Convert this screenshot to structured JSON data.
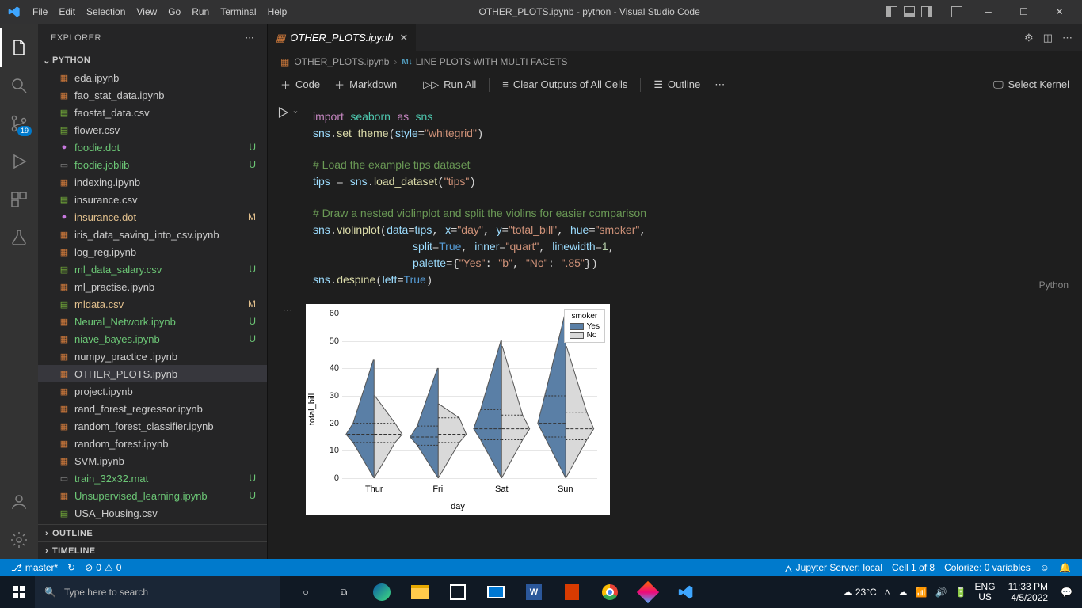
{
  "titlebar": {
    "menu": [
      "File",
      "Edit",
      "Selection",
      "View",
      "Go",
      "Run",
      "Terminal",
      "Help"
    ],
    "title": "OTHER_PLOTS.ipynb - python - Visual Studio Code"
  },
  "activitybar": {
    "scm_badge": "19"
  },
  "sidebar": {
    "title": "EXPLORER",
    "root": "PYTHON",
    "files": [
      {
        "name": "eda.ipynb",
        "icon": "nb",
        "status": ""
      },
      {
        "name": "fao_stat_data.ipynb",
        "icon": "nb",
        "status": ""
      },
      {
        "name": "faostat_data.csv",
        "icon": "csv",
        "status": ""
      },
      {
        "name": "flower.csv",
        "icon": "csv",
        "status": ""
      },
      {
        "name": "foodie.dot",
        "icon": "dot",
        "status": "U"
      },
      {
        "name": "foodie.joblib",
        "icon": "file",
        "status": "U"
      },
      {
        "name": "indexing.ipynb",
        "icon": "nb",
        "status": ""
      },
      {
        "name": "insurance.csv",
        "icon": "csv",
        "status": ""
      },
      {
        "name": "insurance.dot",
        "icon": "dot",
        "status": "M"
      },
      {
        "name": "iris_data_saving_into_csv.ipynb",
        "icon": "nb",
        "status": ""
      },
      {
        "name": "log_reg.ipynb",
        "icon": "nb",
        "status": ""
      },
      {
        "name": "ml_data_salary.csv",
        "icon": "csv",
        "status": "U"
      },
      {
        "name": "ml_practise.ipynb",
        "icon": "nb",
        "status": ""
      },
      {
        "name": "mldata.csv",
        "icon": "csv",
        "status": "M"
      },
      {
        "name": "Neural_Network.ipynb",
        "icon": "nb",
        "status": "U"
      },
      {
        "name": "niave_bayes.ipynb",
        "icon": "nb",
        "status": "U"
      },
      {
        "name": "numpy_practice .ipynb",
        "icon": "nb",
        "status": ""
      },
      {
        "name": "OTHER_PLOTS.ipynb",
        "icon": "nb",
        "status": "",
        "selected": true
      },
      {
        "name": "project.ipynb",
        "icon": "nb",
        "status": ""
      },
      {
        "name": "rand_forest_regressor.ipynb",
        "icon": "nb",
        "status": ""
      },
      {
        "name": "random_forest_classifier.ipynb",
        "icon": "nb",
        "status": ""
      },
      {
        "name": "random_forest.ipynb",
        "icon": "nb",
        "status": ""
      },
      {
        "name": "SVM.ipynb",
        "icon": "nb",
        "status": ""
      },
      {
        "name": "train_32x32.mat",
        "icon": "file",
        "status": "U"
      },
      {
        "name": "Unsupervised_learning.ipynb",
        "icon": "nb",
        "status": "U"
      },
      {
        "name": "USA_Housing.csv",
        "icon": "csv",
        "status": ""
      }
    ],
    "outline": "OUTLINE",
    "timeline": "TIMELINE"
  },
  "editor": {
    "tab_name": "OTHER_PLOTS.ipynb",
    "breadcrumb_file": "OTHER_PLOTS.ipynb",
    "breadcrumb_section": "LINE PLOTS WITH MULTI FACETS",
    "toolbar": {
      "code": "Code",
      "markdown": "Markdown",
      "run_all": "Run All",
      "clear_outputs": "Clear Outputs of All Cells",
      "outline": "Outline",
      "select_kernel": "Select Kernel"
    },
    "cell_lang": "Python"
  },
  "chart_data": {
    "type": "violin",
    "title": "",
    "xlabel": "day",
    "ylabel": "total_bill",
    "ylim": [
      0,
      60
    ],
    "yticks": [
      0,
      10,
      20,
      30,
      40,
      50,
      60
    ],
    "categories": [
      "Thur",
      "Fri",
      "Sat",
      "Sun"
    ],
    "legend_title": "smoker",
    "series": [
      {
        "name": "Yes",
        "color": "#5a7fa6",
        "medians": [
          16,
          15,
          18,
          20
        ],
        "q1": [
          13,
          12,
          14,
          15
        ],
        "q3": [
          20,
          19,
          25,
          30
        ],
        "max": [
          43,
          40,
          50,
          60
        ]
      },
      {
        "name": "No",
        "color": "#d9d9d9",
        "medians": [
          16,
          16,
          18,
          18
        ],
        "q1": [
          13,
          13,
          14,
          14
        ],
        "q3": [
          20,
          22,
          23,
          24
        ],
        "max": [
          30,
          27,
          48,
          48
        ]
      }
    ]
  },
  "statusbar": {
    "branch": "master*",
    "sync": "↻",
    "errors": "0",
    "warnings": "0",
    "jupyter": "Jupyter Server: local",
    "cell_pos": "Cell 1 of 8",
    "colorize": "Colorize: 0 variables"
  },
  "taskbar": {
    "search_placeholder": "Type here to search",
    "weather": "23°C",
    "lang1": "ENG",
    "lang2": "US",
    "time": "11:33 PM",
    "date": "4/5/2022"
  }
}
